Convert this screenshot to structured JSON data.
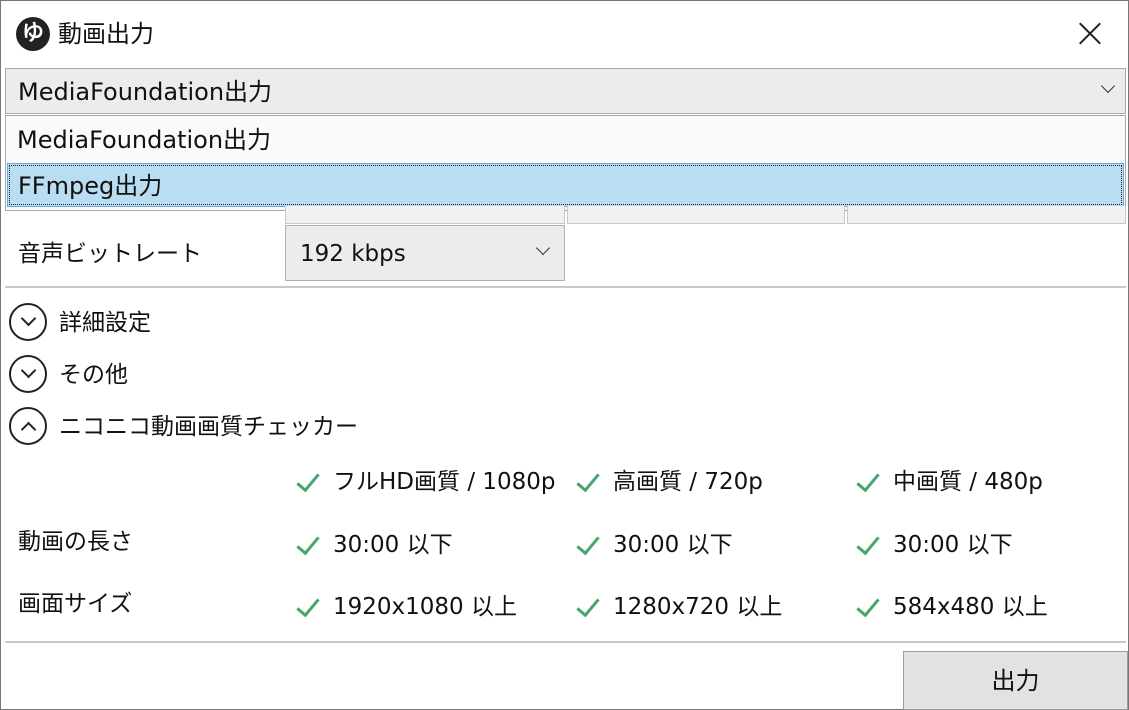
{
  "window": {
    "title": "動画出力",
    "app_icon": "ゆ"
  },
  "output_format": {
    "selected": "MediaFoundation出力",
    "options": [
      "MediaFoundation出力",
      "FFmpeg出力"
    ],
    "highlighted_index": 1
  },
  "audio_bitrate": {
    "label": "音声ビットレート",
    "value": "192 kbps"
  },
  "sections": [
    {
      "label": "詳細設定",
      "state": "collapsed"
    },
    {
      "label": "その他",
      "state": "collapsed"
    },
    {
      "label": "ニコニコ動画画質チェッカー",
      "state": "expanded"
    }
  ],
  "checker": {
    "columns": [
      "フルHD画質 / 1080p",
      "高画質 / 720p",
      "中画質 / 480p"
    ],
    "rows": [
      {
        "label": "動画の長さ",
        "values": [
          "30:00 以下",
          "30:00 以下",
          "30:00 以下"
        ]
      },
      {
        "label": "画面サイズ",
        "values": [
          "1920x1080 以上",
          "1280x720 以上",
          "584x480 以上"
        ]
      }
    ],
    "check_color": "#45a56a"
  },
  "actions": {
    "output_button": "出力"
  }
}
